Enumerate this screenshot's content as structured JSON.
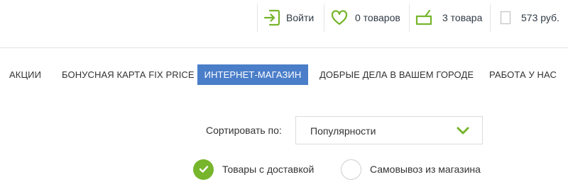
{
  "topbar": {
    "login": {
      "label": "Войти",
      "icon": "login-arrow-icon"
    },
    "favorites": {
      "label": "0 товаров",
      "icon": "heart-icon"
    },
    "cart": {
      "label": "3 товара",
      "icon": "basket-icon"
    },
    "total": {
      "label": "573 руб.",
      "icon": "receipt-icon"
    }
  },
  "nav": {
    "items": [
      {
        "label": "Акции"
      },
      {
        "label": "Бонусная карта Fix Price"
      },
      {
        "label": "Интернет-магазин",
        "active": true
      },
      {
        "label": "Добрые дела в вашем городе"
      },
      {
        "label": "Работа у нас"
      }
    ]
  },
  "sort": {
    "label": "Сортировать по:",
    "selected": "Популярности"
  },
  "delivery": {
    "options": [
      {
        "label": "Товары с доставкой",
        "checked": true
      },
      {
        "label": "Самовывоз из магазина",
        "checked": false
      }
    ]
  },
  "colors": {
    "accent_green": "#77b52c",
    "nav_active": "#4a7ec9",
    "text": "#333333"
  }
}
